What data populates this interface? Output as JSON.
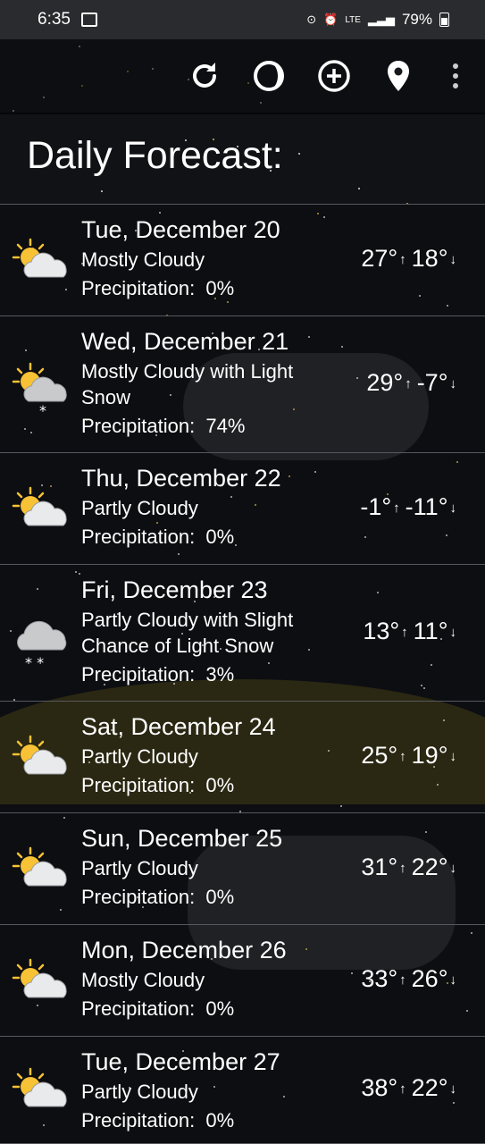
{
  "status_bar": {
    "time": "6:35",
    "network": "LTE",
    "battery": "79%",
    "icons": [
      "image-icon",
      "data-saver-icon",
      "alarm-icon",
      "lte-icon",
      "signal-icon",
      "battery-icon"
    ]
  },
  "toolbar": {
    "icons": [
      "refresh-icon",
      "moon-phase-icon",
      "add-location-icon",
      "location-pin-icon",
      "more-options-icon"
    ]
  },
  "heading": "Daily Forecast:",
  "days": [
    {
      "day": "Tue, December 20",
      "condition": "Mostly Cloudy",
      "precip_label": "Precipitation:",
      "precip": "0%",
      "high": "27°",
      "low": "18°",
      "icon": "sun-cloud-icon"
    },
    {
      "day": "Wed, December 21",
      "condition": "Mostly Cloudy with Light Snow",
      "precip_label": "Precipitation:",
      "precip": "74%",
      "high": "29°",
      "low": "-7°",
      "icon": "sun-cloud-snow-icon"
    },
    {
      "day": "Thu, December 22",
      "condition": "Partly Cloudy",
      "precip_label": "Precipitation:",
      "precip": "0%",
      "high": "-1°",
      "low": "-11°",
      "icon": "sun-cloud-icon"
    },
    {
      "day": "Fri, December 23",
      "condition": "Partly Cloudy with Slight Chance of Light Snow",
      "precip_label": "Precipitation:",
      "precip": "3%",
      "high": "13°",
      "low": "11°",
      "icon": "cloud-snow-icon"
    },
    {
      "day": "Sat, December 24",
      "condition": "Partly Cloudy",
      "precip_label": "Precipitation:",
      "precip": "0%",
      "high": "25°",
      "low": "19°",
      "icon": "sun-cloud-icon"
    },
    {
      "day": "Sun, December 25",
      "condition": "Partly Cloudy",
      "precip_label": "Precipitation:",
      "precip": "0%",
      "high": "31°",
      "low": "22°",
      "icon": "sun-cloud-icon"
    },
    {
      "day": "Mon, December 26",
      "condition": "Mostly Cloudy",
      "precip_label": "Precipitation:",
      "precip": "0%",
      "high": "33°",
      "low": "26°",
      "icon": "sun-cloud-icon"
    },
    {
      "day": "Tue, December 27",
      "condition": "Partly Cloudy",
      "precip_label": "Precipitation:",
      "precip": "0%",
      "high": "38°",
      "low": "22°",
      "icon": "sun-cloud-icon"
    }
  ],
  "arrows": {
    "up": "↑",
    "down": "↓"
  },
  "colors": {
    "background": "#101216",
    "status_bar": "#2a2b2e",
    "sun": "#f7c235",
    "cloud": "#e9eaec",
    "divider": "#55585e"
  }
}
